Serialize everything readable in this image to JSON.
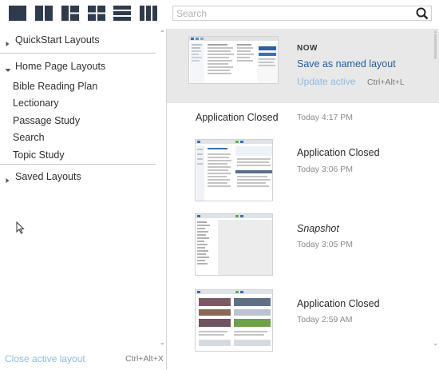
{
  "toolbar": {
    "layout_buttons": [
      {
        "name": "layout-single-icon"
      },
      {
        "name": "layout-two-columns-icon"
      },
      {
        "name": "layout-three-pane-icon"
      },
      {
        "name": "layout-four-grid-icon"
      },
      {
        "name": "layout-rows-icon"
      },
      {
        "name": "layout-three-columns-icon"
      }
    ],
    "icon_color": "#2f3b4c",
    "search": {
      "placeholder": "Search",
      "value": ""
    }
  },
  "sidebar": {
    "groups": [
      {
        "label": "QuickStart Layouts",
        "expanded": false
      },
      {
        "label": "Home Page Layouts",
        "expanded": true,
        "items": [
          "Bible Reading Plan",
          "Lectionary",
          "Passage Study",
          "Search",
          "Topic Study"
        ]
      },
      {
        "label": "Saved Layouts",
        "expanded": false
      }
    ],
    "footer": {
      "close_label": "Close active layout",
      "close_shortcut": "Ctrl+Alt+X"
    }
  },
  "history": {
    "now": {
      "label": "NOW",
      "save_label": "Save as named layout",
      "update_label": "Update active",
      "update_shortcut": "Ctrl+Alt+L"
    },
    "entries": [
      {
        "title": "Application Closed",
        "time": "Today 4:17 PM",
        "has_thumbnail": false
      },
      {
        "title": "Application Closed",
        "time": "Today 3:06 PM",
        "has_thumbnail": true
      },
      {
        "title": "Snapshot",
        "time": "Today 3:05 PM",
        "has_thumbnail": true,
        "italic": true
      },
      {
        "title": "Application Closed",
        "time": "Today 2:59 AM",
        "has_thumbnail": true
      }
    ]
  },
  "colors": {
    "link": "#1f5fa8",
    "link_disabled": "#8dbbe3",
    "selected_bg": "#e8e8e8",
    "divider": "#c9c9c9"
  }
}
